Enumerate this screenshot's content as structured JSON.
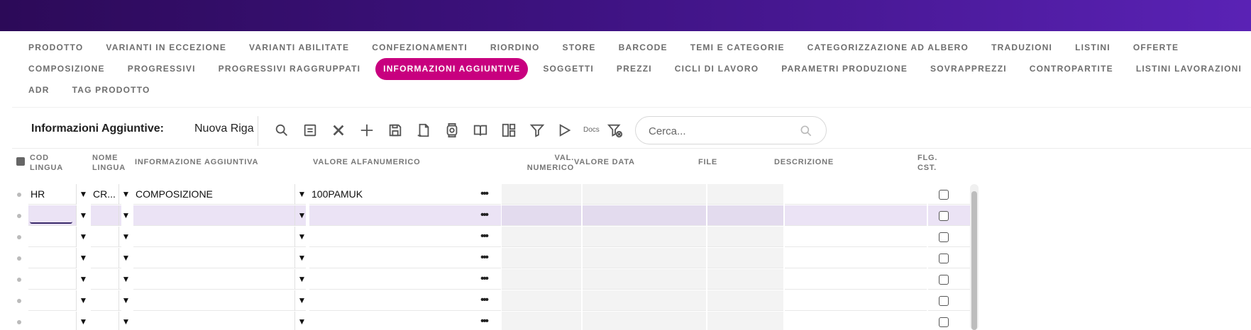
{
  "tabs": {
    "row1": [
      "PRODOTTO",
      "VARIANTI IN ECCEZIONE",
      "VARIANTI ABILITATE",
      "CONFEZIONAMENTI",
      "RIORDINO",
      "STORE",
      "BARCODE",
      "TEMI E CATEGORIE",
      "CATEGORIZZAZIONE AD ALBERO",
      "TRADUZIONI",
      "LISTINI",
      "OFFERTE"
    ],
    "row2": [
      "COMPOSIZIONE",
      "PROGRESSIVI",
      "PROGRESSIVI RAGGRUPPATI",
      "INFORMAZIONI AGGIUNTIVE",
      "SOGGETTI",
      "PREZZI",
      "CICLI DI LAVORO",
      "PARAMETRI PRODUZIONE",
      "SOVRAPPREZZI",
      "CONTROPARTITE",
      "LISTINI LAVORAZIONI"
    ],
    "row3": [
      "ADR",
      "TAG PRODOTTO"
    ],
    "active": "INFORMAZIONI AGGIUNTIVE"
  },
  "toolbar": {
    "title": "Informazioni Aggiuntive:",
    "subtitle": "Nuova Riga",
    "docs_label": "Docs",
    "icons": [
      "search-icon",
      "list-icon",
      "close-icon",
      "plus-icon",
      "save-icon",
      "export-icon",
      "watch-icon",
      "book-icon",
      "layout-icon",
      "filter-icon",
      "docs-icon",
      "filter-clear-icon"
    ],
    "search_placeholder": "Cerca..."
  },
  "grid": {
    "headers": {
      "cod_lingua": [
        "COD",
        "LINGUA"
      ],
      "nome_lingua": [
        "NOME",
        "LINGUA"
      ],
      "info": "INFORMAZIONE AGGIUNTIVA",
      "valore_alfa": "VALORE ALFANUMERICO",
      "val_num": [
        "VAL.",
        "NUMERICO"
      ],
      "valore_data": "VALORE DATA",
      "file": "FILE",
      "descrizione": "DESCRIZIONE",
      "flg": [
        "FLG.",
        "CST."
      ]
    },
    "rows": [
      {
        "cod": "HR",
        "nome": "CR...",
        "info": "COMPOSIZIONE",
        "alfa": "100PAMUK"
      },
      {
        "cod": "",
        "nome": "",
        "info": "",
        "alfa": ""
      },
      {
        "cod": "",
        "nome": "",
        "info": "",
        "alfa": ""
      },
      {
        "cod": "",
        "nome": "",
        "info": "",
        "alfa": ""
      },
      {
        "cod": "",
        "nome": "",
        "info": "",
        "alfa": ""
      },
      {
        "cod": "",
        "nome": "",
        "info": "",
        "alfa": ""
      },
      {
        "cod": "",
        "nome": "",
        "info": "",
        "alfa": ""
      }
    ],
    "dropdown_glyph": "▼",
    "ellipsis_glyph": "•••"
  }
}
